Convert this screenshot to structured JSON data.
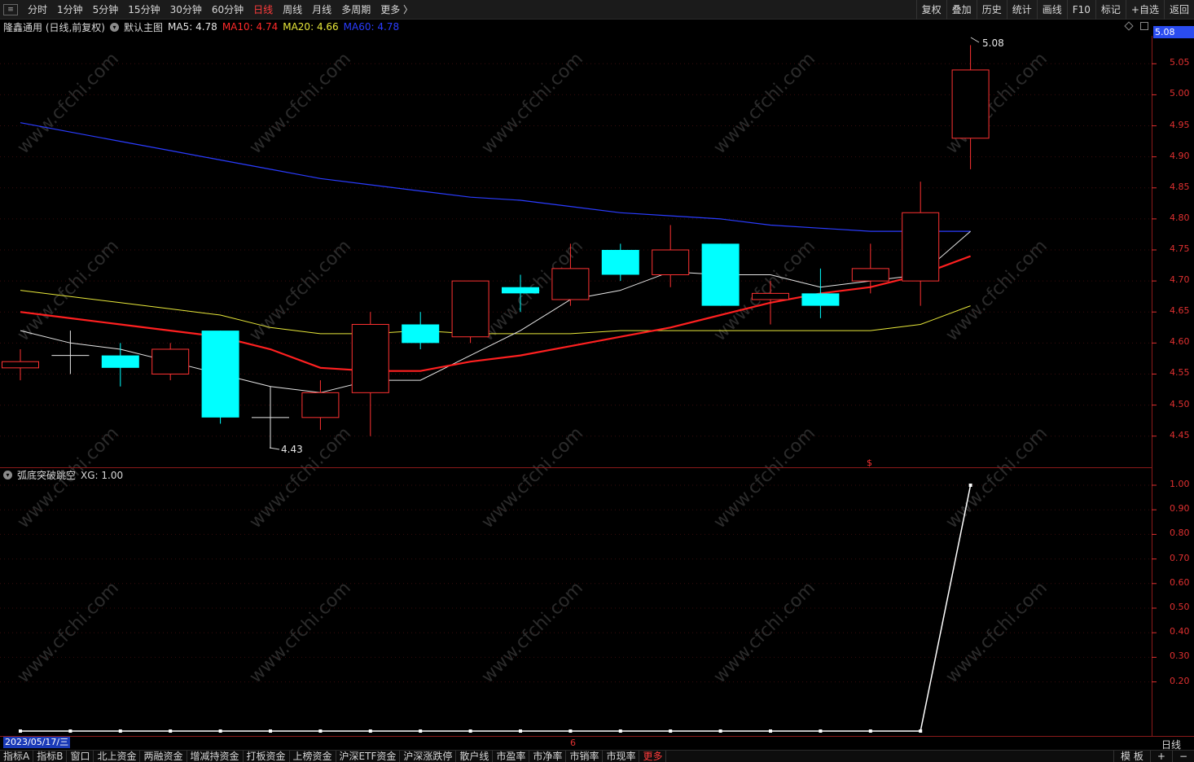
{
  "toolbar": {
    "menu_icon": "menu-icon",
    "periods": [
      "分时",
      "1分钟",
      "5分钟",
      "15分钟",
      "30分钟",
      "60分钟",
      "日线",
      "周线",
      "月线",
      "多周期",
      "更多 〉"
    ],
    "active_period": "日线",
    "tools": [
      "复权",
      "叠加",
      "历史",
      "统计",
      "画线",
      "F10",
      "标记",
      "+自选",
      "返回"
    ]
  },
  "info": {
    "stock": "隆鑫通用 (日线,前复权)",
    "template": "默认主图",
    "ma": [
      {
        "label": "MA5:",
        "value": "4.78",
        "color": "#e6e6e6"
      },
      {
        "label": "MA10:",
        "value": "4.74",
        "color": "#ff2a2a"
      },
      {
        "label": "MA20:",
        "value": "4.66",
        "color": "#e8e83a"
      },
      {
        "label": "MA60:",
        "value": "4.78",
        "color": "#2a3cff"
      }
    ]
  },
  "price_axis": {
    "current": "5.08",
    "ticks": [
      "5.05",
      "5.00",
      "4.95",
      "4.90",
      "4.85",
      "4.80",
      "4.75",
      "4.70",
      "4.65",
      "4.60",
      "4.55",
      "4.50",
      "4.45"
    ]
  },
  "indicator": {
    "name": "弧底突破跳空",
    "value_text": "XG: 1.00",
    "ticks": [
      "1.00",
      "0.90",
      "0.80",
      "0.70",
      "0.60",
      "0.50",
      "0.40",
      "0.30",
      "0.20"
    ]
  },
  "annotations": {
    "high": "5.08",
    "low": "4.43",
    "signal_mark": "$"
  },
  "footer": {
    "date": "2023/05/17/三",
    "month_mark": "6",
    "freq": "日线",
    "tabs": [
      "指标A",
      "指标B",
      "窗口",
      "北上资金",
      "两融资金",
      "增减持资金",
      "打板资金",
      "上榜资金",
      "沪深ETF资金",
      "沪深涨跌停",
      "散户线",
      "市盈率",
      "市净率",
      "市销率",
      "市现率",
      "更多"
    ],
    "tools": [
      "模 板",
      "+",
      "−"
    ]
  },
  "watermark": "www.cfchi.com",
  "colors": {
    "up": "#ff3232",
    "down": "#00ffff",
    "ma5": "#e6e6e6",
    "ma10": "#ff2020",
    "ma20": "#e8e83a",
    "ma60": "#2a3cff",
    "axis": "#e03030"
  },
  "chart_data": {
    "type": "candlestick",
    "y_range": [
      4.405,
      5.095
    ],
    "candles": [
      {
        "o": 4.56,
        "c": 4.57,
        "h": 4.59,
        "l": 4.54
      },
      {
        "o": 4.58,
        "c": 4.58,
        "h": 4.62,
        "l": 4.55
      },
      {
        "o": 4.58,
        "c": 4.56,
        "h": 4.6,
        "l": 4.53
      },
      {
        "o": 4.55,
        "c": 4.59,
        "h": 4.6,
        "l": 4.54
      },
      {
        "o": 4.62,
        "c": 4.48,
        "h": 4.62,
        "l": 4.47
      },
      {
        "o": 4.48,
        "c": 4.48,
        "h": 4.53,
        "l": 4.43
      },
      {
        "o": 4.48,
        "c": 4.52,
        "h": 4.54,
        "l": 4.46
      },
      {
        "o": 4.52,
        "c": 4.63,
        "h": 4.65,
        "l": 4.45
      },
      {
        "o": 4.63,
        "c": 4.6,
        "h": 4.65,
        "l": 4.59
      },
      {
        "o": 4.61,
        "c": 4.7,
        "h": 4.7,
        "l": 4.6
      },
      {
        "o": 4.69,
        "c": 4.68,
        "h": 4.71,
        "l": 4.65
      },
      {
        "o": 4.67,
        "c": 4.72,
        "h": 4.76,
        "l": 4.66
      },
      {
        "o": 4.75,
        "c": 4.71,
        "h": 4.76,
        "l": 4.7
      },
      {
        "o": 4.71,
        "c": 4.75,
        "h": 4.79,
        "l": 4.69
      },
      {
        "o": 4.76,
        "c": 4.66,
        "h": 4.76,
        "l": 4.66
      },
      {
        "o": 4.67,
        "c": 4.68,
        "h": 4.7,
        "l": 4.63
      },
      {
        "o": 4.68,
        "c": 4.66,
        "h": 4.72,
        "l": 4.64
      },
      {
        "o": 4.7,
        "c": 4.72,
        "h": 4.76,
        "l": 4.68
      },
      {
        "o": 4.7,
        "c": 4.81,
        "h": 4.86,
        "l": 4.66
      },
      {
        "o": 4.93,
        "c": 5.04,
        "h": 5.08,
        "l": 4.88
      }
    ],
    "ma5": [
      4.62,
      4.6,
      4.59,
      4.57,
      4.55,
      4.53,
      4.52,
      4.54,
      4.54,
      4.58,
      4.62,
      4.67,
      4.685,
      4.715,
      4.71,
      4.71,
      4.69,
      4.7,
      4.71,
      4.78
    ],
    "ma10": [
      4.65,
      4.64,
      4.63,
      4.62,
      4.61,
      4.59,
      4.56,
      4.555,
      4.555,
      4.57,
      4.58,
      4.595,
      4.61,
      4.625,
      4.645,
      4.665,
      4.68,
      4.69,
      4.71,
      4.74
    ],
    "ma20": [
      4.685,
      4.675,
      4.665,
      4.655,
      4.645,
      4.625,
      4.615,
      4.615,
      4.62,
      4.615,
      4.615,
      4.615,
      4.62,
      4.62,
      4.62,
      4.62,
      4.62,
      4.62,
      4.63,
      4.66
    ],
    "ma60": [
      4.955,
      4.94,
      4.925,
      4.91,
      4.895,
      4.88,
      4.865,
      4.855,
      4.845,
      4.835,
      4.83,
      4.82,
      4.81,
      4.805,
      4.8,
      4.79,
      4.785,
      4.78,
      4.78,
      4.78
    ],
    "xg": [
      0,
      0,
      0,
      0,
      0,
      0,
      0,
      0,
      0,
      0,
      0,
      0,
      0,
      0,
      0,
      0,
      0,
      0,
      0,
      1
    ]
  }
}
